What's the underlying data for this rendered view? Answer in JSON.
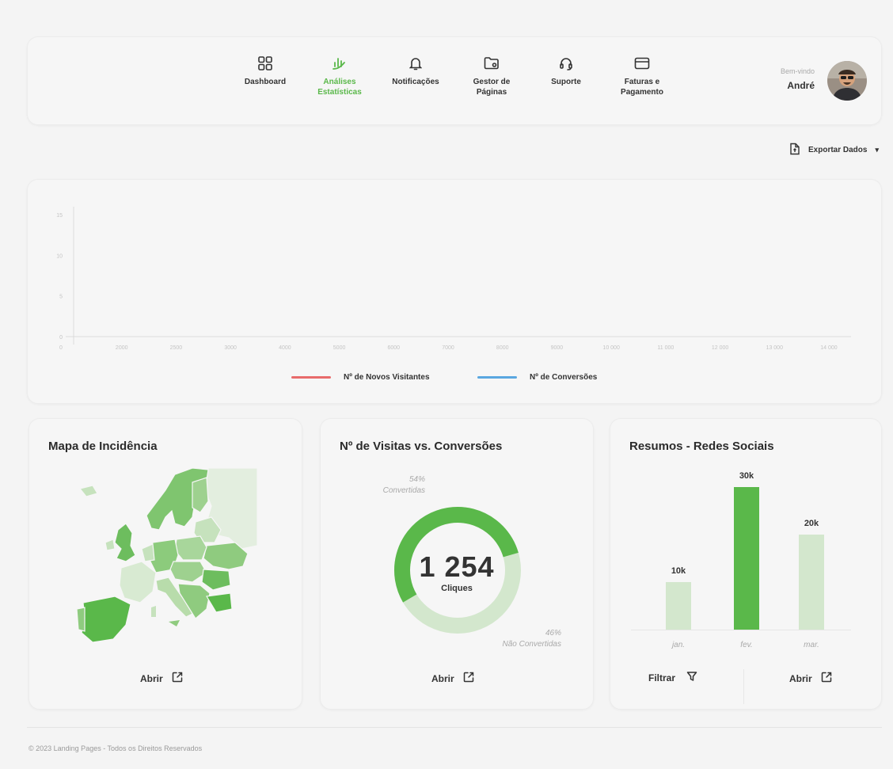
{
  "nav": [
    {
      "label": "Dashboard",
      "icon": "dashboard-icon",
      "active": false
    },
    {
      "label": "Análises Estatísticas",
      "icon": "analytics-icon",
      "active": true
    },
    {
      "label": "Notificações",
      "icon": "bell-icon",
      "active": false
    },
    {
      "label": "Gestor de Páginas",
      "icon": "folder-icon",
      "active": false
    },
    {
      "label": "Suporte",
      "icon": "headset-icon",
      "active": false
    },
    {
      "label": "Faturas e Pagamento",
      "icon": "card-icon",
      "active": false
    }
  ],
  "user": {
    "greeting": "Bem-vindo",
    "name": "André"
  },
  "export_label": "Exportar Dados",
  "colors": {
    "accent": "#5ab84a",
    "accent_light": "#d3e7cd",
    "visitors": "#e86b6b",
    "conversions": "#5aa7e0"
  },
  "chart_data": {
    "type": "line",
    "title": "",
    "x_ticks": [
      "0",
      "2000",
      "2500",
      "3000",
      "4000",
      "5000",
      "6000",
      "7000",
      "8000",
      "9000",
      "10 000",
      "11 000",
      "12 000",
      "13 000",
      "14 000"
    ],
    "y_ticks": [
      "0",
      "5",
      "10",
      "15"
    ],
    "series": [
      {
        "name": "Nº de Novos Visitantes",
        "color": "#e86b6b",
        "values": []
      },
      {
        "name": "Nº de Conversões",
        "color": "#5aa7e0",
        "values": []
      }
    ]
  },
  "map_card": {
    "title": "Mapa de Incidência",
    "open_label": "Abrir"
  },
  "donut_card": {
    "title": "Nº de Visitas vs. Conversões",
    "value": "1 254",
    "unit": "Cliques",
    "converted_pct": "54%",
    "converted_label": "Convertidas",
    "not_converted_pct": "46%",
    "not_converted_label": "Não Convertidas",
    "converted_fraction": 0.54,
    "open_label": "Abrir"
  },
  "social_card": {
    "title": "Resumos - Redes Sociais",
    "bars": [
      {
        "label": "10k",
        "value": 10000,
        "month": "jan.",
        "highlight": false
      },
      {
        "label": "30k",
        "value": 30000,
        "month": "fev.",
        "highlight": true
      },
      {
        "label": "20k",
        "value": 20000,
        "month": "mar.",
        "highlight": false
      }
    ],
    "filter_label": "Filtrar",
    "open_label": "Abrir"
  },
  "footer": "© 2023 Landing Pages - Todos os Direitos Reservados"
}
